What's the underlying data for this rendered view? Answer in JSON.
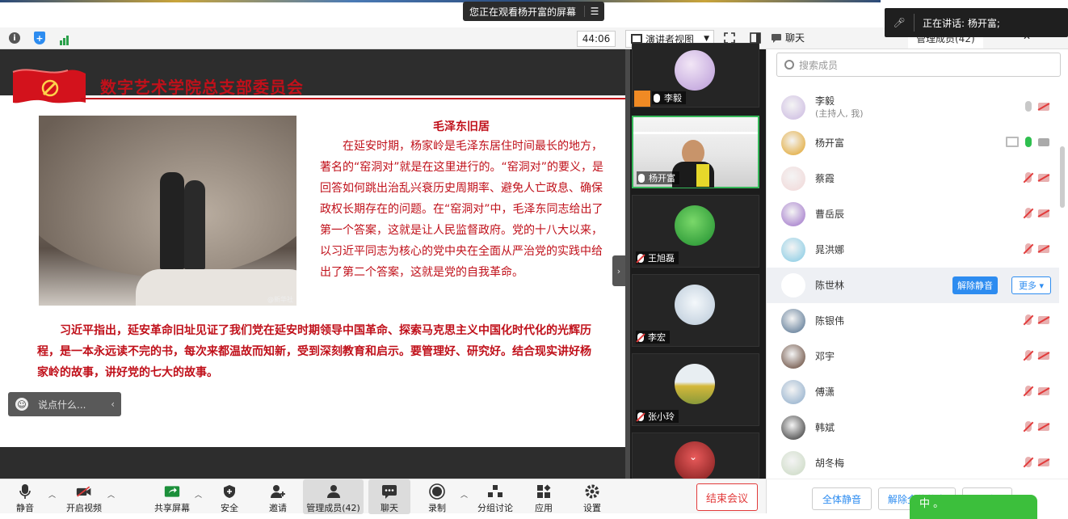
{
  "banner": {
    "sharing_text": "您正在观看杨开富的屏幕"
  },
  "speaking": {
    "text": "正在讲话: 杨开富;"
  },
  "toolbar": {
    "timer": "44:06",
    "view_mode": "演讲者视图"
  },
  "side_tabs": {
    "chat": "聊天",
    "members": "管理成员(42)",
    "close": "✕"
  },
  "slide": {
    "title": "数字艺术学院总支部委员会",
    "subtitle": "毛泽东旧居",
    "paragraph1": "在延安时期，杨家岭是毛泽东居住时间最长的地方，著名的“窑洞对”就是在这里进行的。“窑洞对”的要义，是回答如何跳出治乱兴衰历史周期率、避免人亡政息、确保政权长期存在的问题。在“窑洞对”中，毛泽东同志给出了第一个答案，这就是让人民监督政府。党的十八大以来，以习近平同志为核心的党中央在全面从严治党的实践中给出了第二个答案，这就是党的自我革命。",
    "paragraph2": "习近平指出，延安革命旧址见证了我们党在延安时期领导中国革命、探索马克思主义中国化时代化的光辉历程，是一本永远读不完的书，每次来都温故而知新，受到深刻教育和启示。要管理好、研究好。结合现实讲好杨家岭的故事，讲好党的七大的故事。",
    "photo_watermark": "@新华社"
  },
  "comment": {
    "placeholder": "说点什么..."
  },
  "video_tiles": [
    {
      "name": "李毅",
      "color": "#c9b6e0",
      "muted": false,
      "host": true
    },
    {
      "name": "杨开富",
      "color": "#e0e0e0",
      "muted": false,
      "host": false
    },
    {
      "name": "王旭磊",
      "color": "#2fa63a",
      "muted": true,
      "host": false
    },
    {
      "name": "李宏",
      "color": "#dfe6ee",
      "muted": true,
      "host": false
    },
    {
      "name": "张小玲",
      "color": "#c7b33a",
      "muted": true,
      "host": false
    }
  ],
  "members": {
    "search_placeholder": "搜索成员",
    "list": [
      {
        "name": "李毅",
        "sub": "(主持人, 我)",
        "color": "#c9b6e0",
        "mic": "gray",
        "cam": "red"
      },
      {
        "name": "杨开富",
        "sub": "",
        "color": "#e0a020",
        "mic": "green",
        "cam": "gray"
      },
      {
        "name": "蔡霞",
        "sub": "",
        "color": "#f1d6d6",
        "mic": "red",
        "cam": "red"
      },
      {
        "name": "曹岳辰",
        "sub": "",
        "color": "#9a6cc7",
        "mic": "red",
        "cam": "red"
      },
      {
        "name": "晁洪娜",
        "sub": "",
        "color": "#7ec8e3",
        "mic": "red",
        "cam": "red"
      },
      {
        "name": "陈世林",
        "sub": "",
        "color": "#d8d8d8",
        "mic": "",
        "cam": ""
      },
      {
        "name": "陈银伟",
        "sub": "",
        "color": "#4a6a8a",
        "mic": "red",
        "cam": "red"
      },
      {
        "name": "邓宇",
        "sub": "",
        "color": "#5a3a2a",
        "mic": "red",
        "cam": "red"
      },
      {
        "name": "傅潇",
        "sub": "",
        "color": "#88a8c8",
        "mic": "red",
        "cam": "red"
      },
      {
        "name": "韩斌",
        "sub": "",
        "color": "#2a2a2a",
        "mic": "red",
        "cam": "red"
      },
      {
        "name": "胡冬梅",
        "sub": "",
        "color": "#c8d8c0",
        "mic": "red",
        "cam": "red"
      }
    ],
    "unmute_label": "解除静音",
    "more_label": "更多 ▾"
  },
  "side_footer": {
    "mute_all": "全体静音",
    "unmute_all": "解除全体静音",
    "more": "更多"
  },
  "popup": {
    "text": "中 。"
  },
  "bottom_bar": {
    "mute": "静音",
    "start_video": "开启视频",
    "share_screen": "共享屏幕",
    "security": "安全",
    "invite": "邀请",
    "manage_members": "管理成员(42)",
    "chat": "聊天",
    "record": "录制",
    "breakout": "分组讨论",
    "apps": "应用",
    "settings": "设置",
    "end_meeting": "结束会议"
  },
  "colors": {
    "accent": "#2d8cf0",
    "slide_red": "#c0101a",
    "danger": "#e23b3b",
    "talking_green": "#2fbf4f"
  }
}
